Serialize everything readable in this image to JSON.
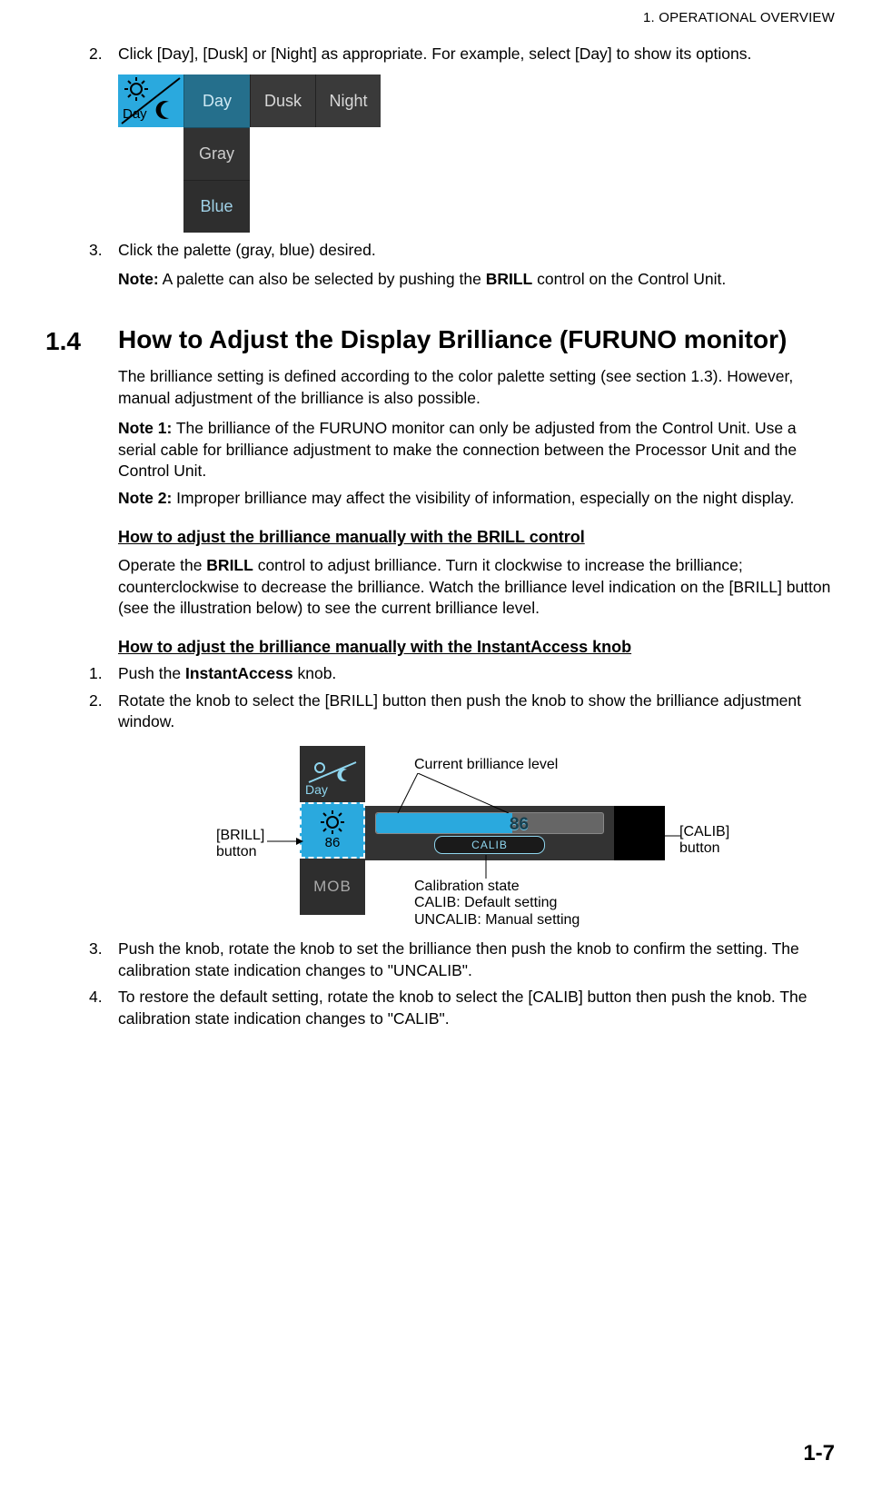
{
  "header": {
    "running": "1.  OPERATIONAL OVERVIEW"
  },
  "topList": {
    "item2": {
      "num": "2.",
      "text": "Click [Day], [Dusk] or [Night] as appropriate. For example, select [Day] to show its options."
    },
    "item3": {
      "num": "3.",
      "text": "Click the palette (gray, blue) desired."
    }
  },
  "fig1": {
    "tiles": {
      "dayIconLabel": "Day",
      "day": "Day",
      "dusk": "Dusk",
      "night": "Night",
      "gray": "Gray",
      "blue": "Blue"
    }
  },
  "note": {
    "label": "Note:",
    "text": " A palette can also be selected by pushing the ",
    "bold": "BRILL",
    "text2": " control on the Control Unit."
  },
  "section": {
    "num": "1.4",
    "title": "How to Adjust the Display Brilliance (FURUNO monitor)"
  },
  "para1": "The brilliance setting is defined according to the color palette setting (see section 1.3). However, manual adjustment of the brilliance is also possible.",
  "note1": {
    "label": "Note 1:",
    "text": " The brilliance of the FURUNO monitor can only be adjusted from the Control Unit. Use a serial cable for brilliance adjustment to make the connection between the Processor Unit and the Control Unit."
  },
  "note2": {
    "label": "Note 2:",
    "text": " Improper brilliance may affect the visibility of information, especially on the night display."
  },
  "subA": {
    "title": "How to adjust the brilliance manually with the BRILL control",
    "text_a": "Operate the ",
    "bold": "BRILL",
    "text_b": " control to adjust brilliance. Turn it clockwise to increase the bril­liance; counterclockwise to decrease the brilliance. Watch the brilliance level indica­tion on the [BRILL] button (see the illustration below) to see the current brilliance level."
  },
  "subB": {
    "title": "How to adjust the brilliance manually with the InstantAccess knob",
    "step1": {
      "num": "1.",
      "text_a": "Push the ",
      "bold": "InstantAccess",
      "text_b": " knob."
    },
    "step2": {
      "num": "2.",
      "text": "Rotate the knob to select the [BRILL] button then push the knob to show the bril­liance adjustment window."
    },
    "step3": {
      "num": "3.",
      "text": "Push the knob, rotate the knob to set the brilliance then push the knob to confirm the setting. The calibration state indication changes to \"UNCALIB\"."
    },
    "step4": {
      "num": "4.",
      "text": "To restore the default setting, rotate the knob to select the [CALIB] button then push the knob. The calibration state indication changes to \"CALIB\"."
    }
  },
  "fig2": {
    "day": "Day",
    "brillValue": "86",
    "mob": "MOB",
    "sliderValue": "86",
    "calibPill": "CALIB",
    "ann": {
      "brillBtn1": "[BRILL]",
      "brillBtn2": "button",
      "curLevel": "Current brilliance level",
      "calState1": "Calibration state",
      "calState2": "CALIB: Default setting",
      "calState3": "UNCALIB: Manual setting",
      "calibBtn1": "[CALIB]",
      "calibBtn2": "button"
    }
  },
  "footer": {
    "pagenum": "1-7"
  }
}
